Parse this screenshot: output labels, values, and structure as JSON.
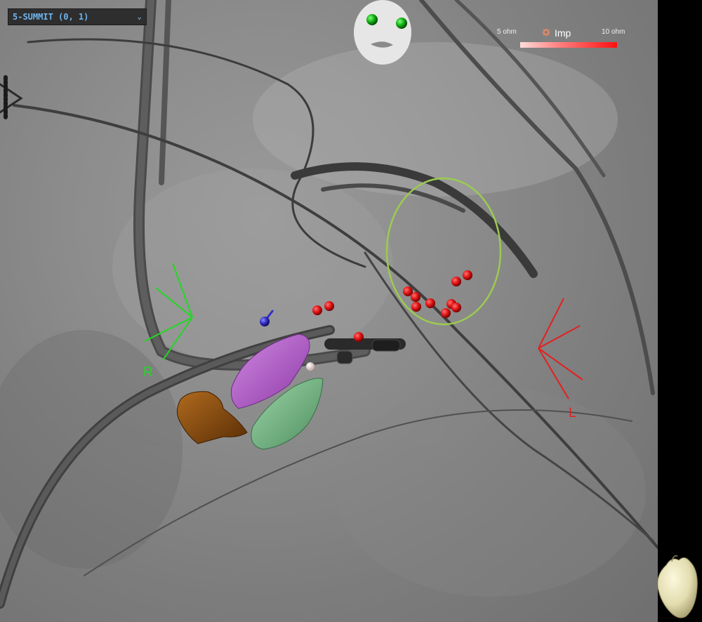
{
  "view_selector": {
    "value": "5-SUMMIT (0, 1)",
    "chevron_icon": "chevron-down-icon"
  },
  "impedance_legend": {
    "min_label": "5 ohm",
    "title": "Imp",
    "max_label": "10 ohm",
    "icon": "gear-icon",
    "gradient_colors": [
      "#ffdcdc",
      "#ff1010"
    ]
  },
  "orientation": {
    "right_label": "R",
    "left_label": "L",
    "right_color": "#22d822",
    "left_color": "#e42020"
  },
  "overlays": {
    "head_icon": "patient-head-icon",
    "heart_icon": "heart-model-icon",
    "region_ring_color": "#9ccb4f",
    "ablation_point_color": "#e01414",
    "ablation_points_count": 16,
    "structures": [
      {
        "name": "purple-anatomy-mesh",
        "color": "#b25fc7"
      },
      {
        "name": "green-anatomy-mesh",
        "color": "#6fae7d"
      },
      {
        "name": "brown-anatomy-mesh",
        "color": "#8a4b10"
      }
    ]
  }
}
